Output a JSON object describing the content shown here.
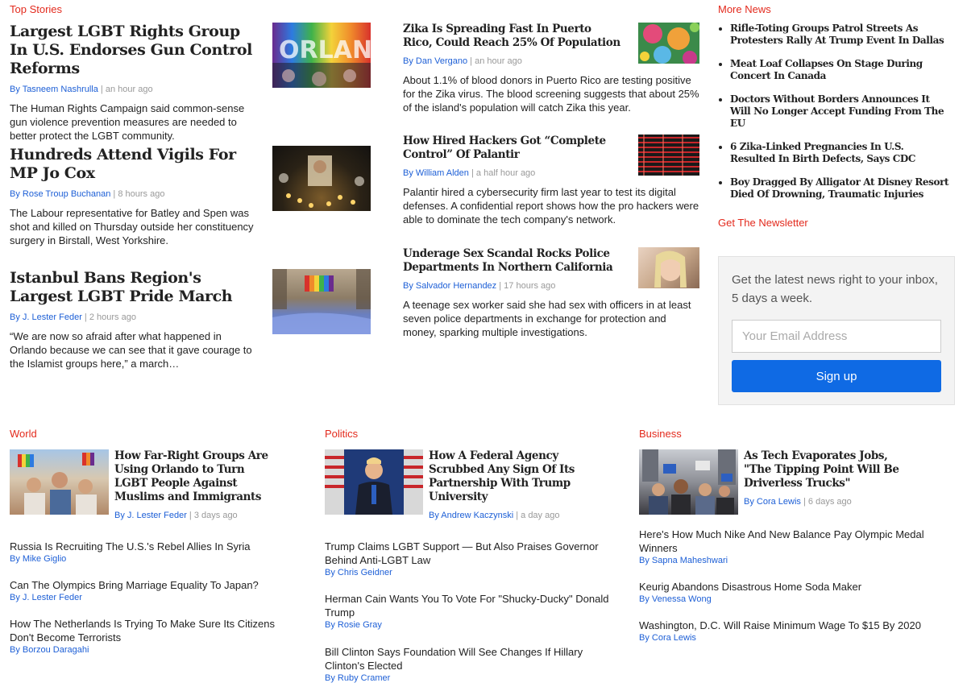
{
  "top_stories": {
    "section_label": "Top Stories",
    "left": [
      {
        "headline": "Largest LGBT Rights Group In U.S. Endorses Gun Control Reforms",
        "author": "By Tasneem Nashrulla",
        "time": "an hour ago",
        "summary": "The Human Rights Campaign said common-sense gun violence prevention measures are needed to better protect the LGBT community.",
        "image": "rainbow-letters-photo"
      },
      {
        "headline": "Hundreds Attend Vigils For MP Jo Cox",
        "author": "By Rose Troup Buchanan",
        "time": "8 hours ago",
        "summary": "The Labour representative for Batley and Spen was shot and killed on Thursday outside her constituency surgery in Birstall, West Yorkshire.",
        "image": "candlelight-vigil-photo"
      },
      {
        "headline": "Istanbul Bans Region's Largest LGBT Pride March",
        "author": "By J. Lester Feder",
        "time": "2 hours ago",
        "summary": "“We are now so afraid after what happened in Orlando because we can see that it gave courage to the Islamist groups here,” a march…",
        "image": "pride-march-photo"
      }
    ],
    "middle": [
      {
        "headline": "Zika Is Spreading Fast In Puerto Rico, Could Reach 25% Of Population",
        "author": "By Dan Vergano",
        "time": "an hour ago",
        "summary": "About 1.1% of blood donors in Puerto Rico are testing positive for the Zika virus. The blood screening suggests that about 25% of the island's population will catch Zika this year.",
        "image": "virus-illustration"
      },
      {
        "headline": "How Hired Hackers Got “Complete Control” Of Palantir",
        "author": "By William Alden",
        "time": "a half hour ago",
        "summary": "Palantir hired a cybersecurity firm last year to test its digital defenses. A confidential report shows how the pro hackers were able to dominate the tech company's network.",
        "image": "data-screen-photo"
      },
      {
        "headline": "Underage Sex Scandal Rocks Police Departments In Northern California",
        "author": "By Salvador Hernandez",
        "time": "17 hours ago",
        "summary": "A teenage sex worker said she had sex with officers in at least seven police departments in exchange for protection and money, sparking multiple investigations.",
        "image": "selfie-photo"
      }
    ]
  },
  "more_news": {
    "section_label": "More News",
    "items": [
      "Rifle-Toting Groups Patrol Streets As Protesters Rally At Trump Event In Dallas",
      "Meat Loaf Collapses On Stage During Concert In Canada",
      "Doctors Without Borders Announces It Will No Longer Accept Funding From The EU",
      "6 Zika-Linked Pregnancies In U.S. Resulted In Birth Defects, Says CDC",
      "Boy Dragged By Alligator At Disney Resort Died Of Drowning, Traumatic Injuries"
    ]
  },
  "newsletter": {
    "section_label": "Get The Newsletter",
    "text": "Get the latest news right to your inbox, 5 days a week.",
    "placeholder": "Your Email Address",
    "button": "Sign up"
  },
  "world": {
    "section_label": "World",
    "feature": {
      "headline": "How Far-Right Groups Are Using Orlando to Turn LGBT People Against Muslims and Immigrants",
      "author": "By J. Lester Feder",
      "time": "3 days ago",
      "image": "rally-crowd-photo"
    },
    "links": [
      {
        "headline": "Russia Is Recruiting The U.S.'s Rebel Allies In Syria",
        "author": "By Mike Giglio"
      },
      {
        "headline": "Can The Olympics Bring Marriage Equality To Japan?",
        "author": "By J. Lester Feder"
      },
      {
        "headline": "How The Netherlands Is Trying To Make Sure Its Citizens Don't Become Terrorists",
        "author": "By Borzou Daragahi"
      }
    ]
  },
  "politics": {
    "section_label": "Politics",
    "feature": {
      "headline": "How A Federal Agency Scrubbed Any Sign Of Its Partnership With Trump University",
      "author": "By Andrew Kaczynski",
      "time": "a day ago",
      "image": "podium-flags-photo"
    },
    "links": [
      {
        "headline": "Trump Claims LGBT Support — But Also Praises Governor Behind Anti-LGBT Law",
        "author": "By Chris Geidner"
      },
      {
        "headline": "Herman Cain Wants You To Vote For \"Shucky-Ducky\" Donald Trump",
        "author": "By Rosie Gray"
      },
      {
        "headline": "Bill Clinton Says Foundation Will See Changes If Hillary Clinton's Elected",
        "author": "By Ruby Cramer"
      }
    ]
  },
  "business": {
    "section_label": "Business",
    "feature": {
      "headline": "As Tech Evaporates Jobs, \"The Tipping Point Will Be Driverless Trucks\"",
      "author": "By Cora Lewis",
      "time": "6 days ago",
      "image": "protest-street-photo"
    },
    "links": [
      {
        "headline": "Here's How Much Nike And New Balance Pay Olympic Medal Winners",
        "author": "By Sapna Maheshwari"
      },
      {
        "headline": "Keurig Abandons Disastrous Home Soda Maker",
        "author": "By Venessa Wong"
      },
      {
        "headline": "Washington, D.C. Will Raise Minimum Wage To $15 By 2020",
        "author": "By Cora Lewis"
      }
    ]
  },
  "colors": {
    "section_red": "#e32a1d",
    "link_blue": "#1d5fd6",
    "button_blue": "#0f6ae4"
  }
}
